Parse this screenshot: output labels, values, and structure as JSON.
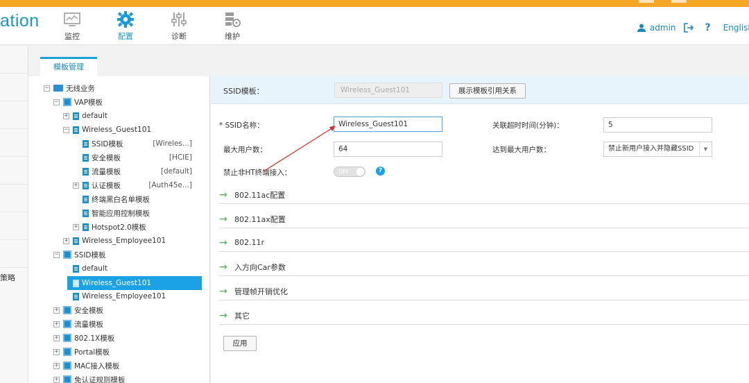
{
  "header": {
    "brand": "ation",
    "nav": [
      {
        "label": "监控",
        "icon": "monitor-icon"
      },
      {
        "label": "配置",
        "icon": "gear-icon"
      },
      {
        "label": "诊断",
        "icon": "sliders-icon"
      },
      {
        "label": "维护",
        "icon": "maintenance-icon"
      }
    ],
    "user": "admin",
    "help": "?",
    "language": "English"
  },
  "leftnav": {
    "partial_label": "策略"
  },
  "tabs": [
    {
      "label": "模板管理"
    }
  ],
  "tree": {
    "items": [
      {
        "label": "无线业务",
        "value": ""
      },
      {
        "label": "VAP模板",
        "value": ""
      },
      {
        "label": "default",
        "value": ""
      },
      {
        "label": "Wireless_Guest101",
        "value": ""
      },
      {
        "label": "SSID模板",
        "value": "[Wireles...]"
      },
      {
        "label": "安全模板",
        "value": "[HCIE]"
      },
      {
        "label": "流量模板",
        "value": "[default]"
      },
      {
        "label": "认证模板",
        "value": "[Auth45e...]"
      },
      {
        "label": "终端黑白名单模板",
        "value": ""
      },
      {
        "label": "智能应用控制模板",
        "value": ""
      },
      {
        "label": "Hotspot2.0模板",
        "value": ""
      },
      {
        "label": "Wireless_Employee101",
        "value": ""
      },
      {
        "label": "SSID模板",
        "value": ""
      },
      {
        "label": "default",
        "value": ""
      },
      {
        "label": "Wireless_Guest101",
        "value": ""
      },
      {
        "label": "Wireless_Employee101",
        "value": ""
      },
      {
        "label": "安全模板",
        "value": ""
      },
      {
        "label": "流量模板",
        "value": ""
      },
      {
        "label": "802.1X模板",
        "value": ""
      },
      {
        "label": "Portal模板",
        "value": ""
      },
      {
        "label": "MAC接入模板",
        "value": ""
      },
      {
        "label": "免认证规则模板",
        "value": ""
      }
    ]
  },
  "content": {
    "template_label": "SSID模板：",
    "template_value": "Wireless_Guest101",
    "show_relation_button": "展示模板引用关系",
    "fields": {
      "ssid_name_label": "* SSID名称：",
      "ssid_name_value": "Wireless_Guest101",
      "timeout_label": "关联超时时间(分钟)：",
      "timeout_value": "5",
      "max_users_label": "最大用户数：",
      "max_users_value": "64",
      "reach_max_label": "达到最大用户数：",
      "reach_max_value": "禁止新用户接入并隐藏SSID",
      "ban_nonht_label": "禁止非HT终端接入：",
      "ban_nonht_state": "OFF"
    },
    "sections": [
      {
        "label": "802.11ac配置"
      },
      {
        "label": "802.11ax配置"
      },
      {
        "label": "802.11r"
      },
      {
        "label": "入方向Car参数"
      },
      {
        "label": "管理帧开销优化"
      },
      {
        "label": "其它"
      }
    ],
    "apply_button": "应用"
  },
  "colors": {
    "accent": "#1aa1e6",
    "top_strip": "#f5a623",
    "annotation_arrow": "#d0302a"
  }
}
